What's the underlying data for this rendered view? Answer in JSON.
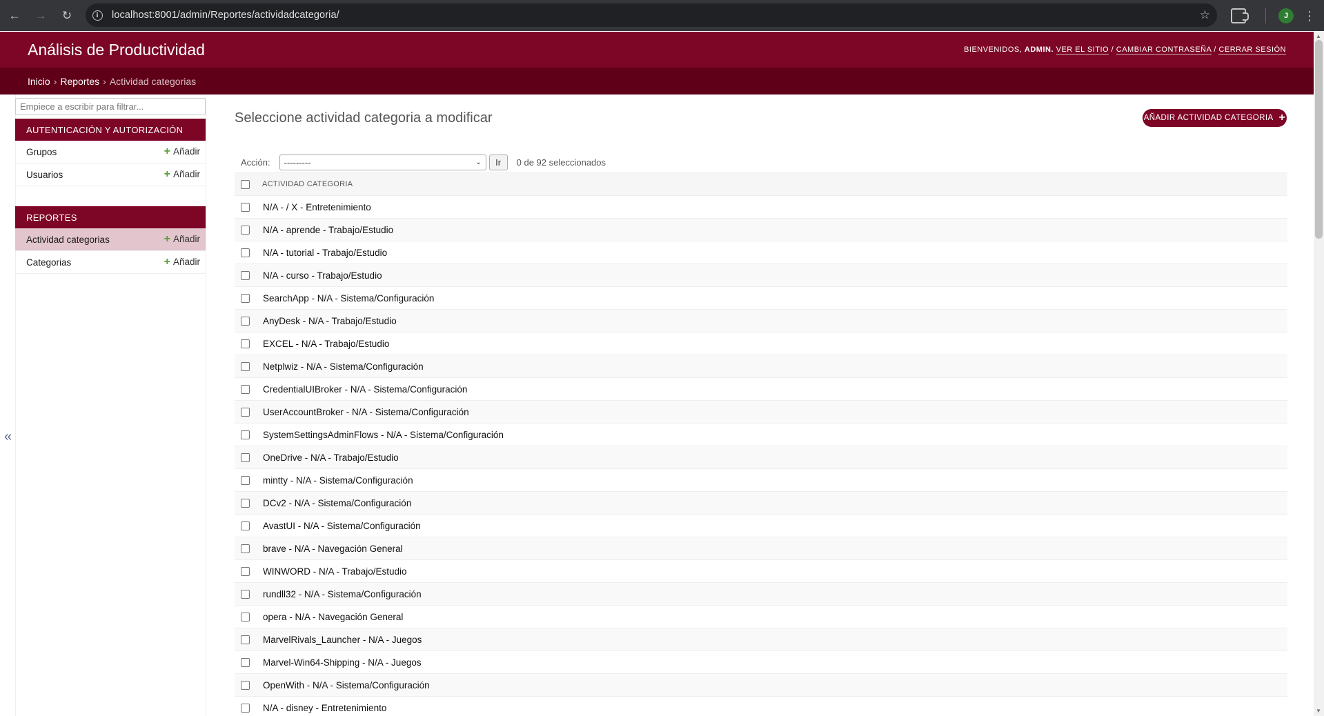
{
  "browser": {
    "url": "localhost:8001/admin/Reportes/actividadcategoria/",
    "profile_initial": "J"
  },
  "header": {
    "site_title": "Análisis de Productividad",
    "welcome": "BIENVENIDOS,",
    "username": "ADMIN.",
    "view_site": "VER EL SITIO",
    "change_password": "CAMBIAR CONTRASEÑA",
    "logout": "CERRAR SESIÓN",
    "sep": "/"
  },
  "breadcrumbs": [
    "Inicio",
    "Reportes",
    "Actividad categorias"
  ],
  "sidebar": {
    "filter_placeholder": "Empiece a escribir para filtrar...",
    "add_label": "Añadir",
    "modules": [
      {
        "caption": "AUTENTICACIÓN Y AUTORIZACIÓN",
        "items": [
          "Grupos",
          "Usuarios"
        ]
      },
      {
        "caption": "REPORTES",
        "items": [
          "Actividad categorias",
          "Categorias"
        ]
      }
    ],
    "collapse_label": "«"
  },
  "main": {
    "title": "Seleccione actividad categoria a modificar",
    "add_button": "AÑADIR ACTIVIDAD CATEGORIA",
    "action_label": "Acción:",
    "action_selected": "---------",
    "go_label": "Ir",
    "counter": "0 de 92 seleccionados",
    "column_header": "ACTIVIDAD CATEGORIA",
    "rows": [
      "N/A - / X - Entretenimiento",
      "N/A - aprende - Trabajo/Estudio",
      "N/A - tutorial - Trabajo/Estudio",
      "N/A - curso - Trabajo/Estudio",
      "SearchApp - N/A - Sistema/Configuración",
      "AnyDesk - N/A - Trabajo/Estudio",
      "EXCEL - N/A - Trabajo/Estudio",
      "Netplwiz - N/A - Sistema/Configuración",
      "CredentialUIBroker - N/A - Sistema/Configuración",
      "UserAccountBroker - N/A - Sistema/Configuración",
      "SystemSettingsAdminFlows - N/A - Sistema/Configuración",
      "OneDrive - N/A - Trabajo/Estudio",
      "mintty - N/A - Sistema/Configuración",
      "DCv2 - N/A - Sistema/Configuración",
      "AvastUI - N/A - Sistema/Configuración",
      "brave - N/A - Navegación General",
      "WINWORD - N/A - Trabajo/Estudio",
      "rundll32 - N/A - Sistema/Configuración",
      "opera - N/A - Navegación General",
      "MarvelRivals_Launcher - N/A - Juegos",
      "Marvel-Win64-Shipping - N/A - Juegos",
      "OpenWith - N/A - Sistema/Configuración",
      "N/A - disney - Entretenimiento"
    ]
  }
}
